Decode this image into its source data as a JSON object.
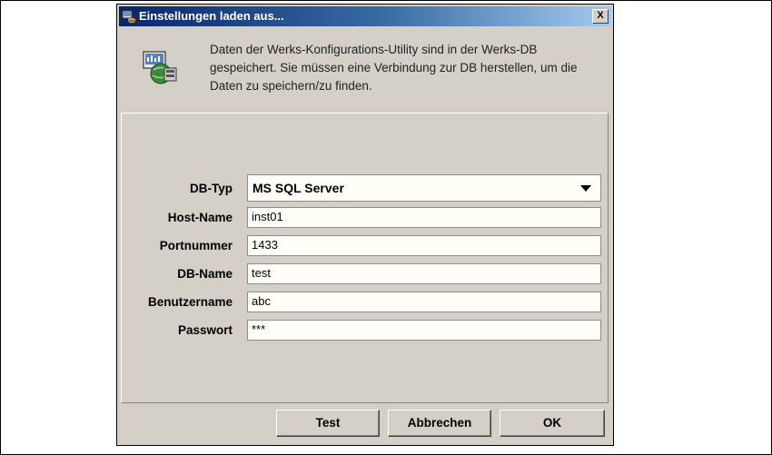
{
  "dialog": {
    "title": "Einstellungen laden aus...",
    "close_label": "X",
    "title_icon": "db-settings-icon",
    "info_icon": "database-config-icon",
    "info_text": "Daten der Werks-Konfigurations-Utility sind in der Werks-DB gespeichert. Sie müssen eine Verbindung zur DB herstellen, um die Daten zu speichern/zu finden."
  },
  "form": {
    "db_type_label": "DB-Typ",
    "db_type_value": "MS SQL Server",
    "host_label": "Host-Name",
    "host_value": "inst01",
    "port_label": "Portnummer",
    "port_value": "1433",
    "dbname_label": "DB-Name",
    "dbname_value": "test",
    "user_label": "Benutzername",
    "user_value": "abc",
    "password_label": "Passwort",
    "password_value": "***"
  },
  "buttons": {
    "test": "Test",
    "cancel": "Abbrechen",
    "ok": "OK"
  }
}
